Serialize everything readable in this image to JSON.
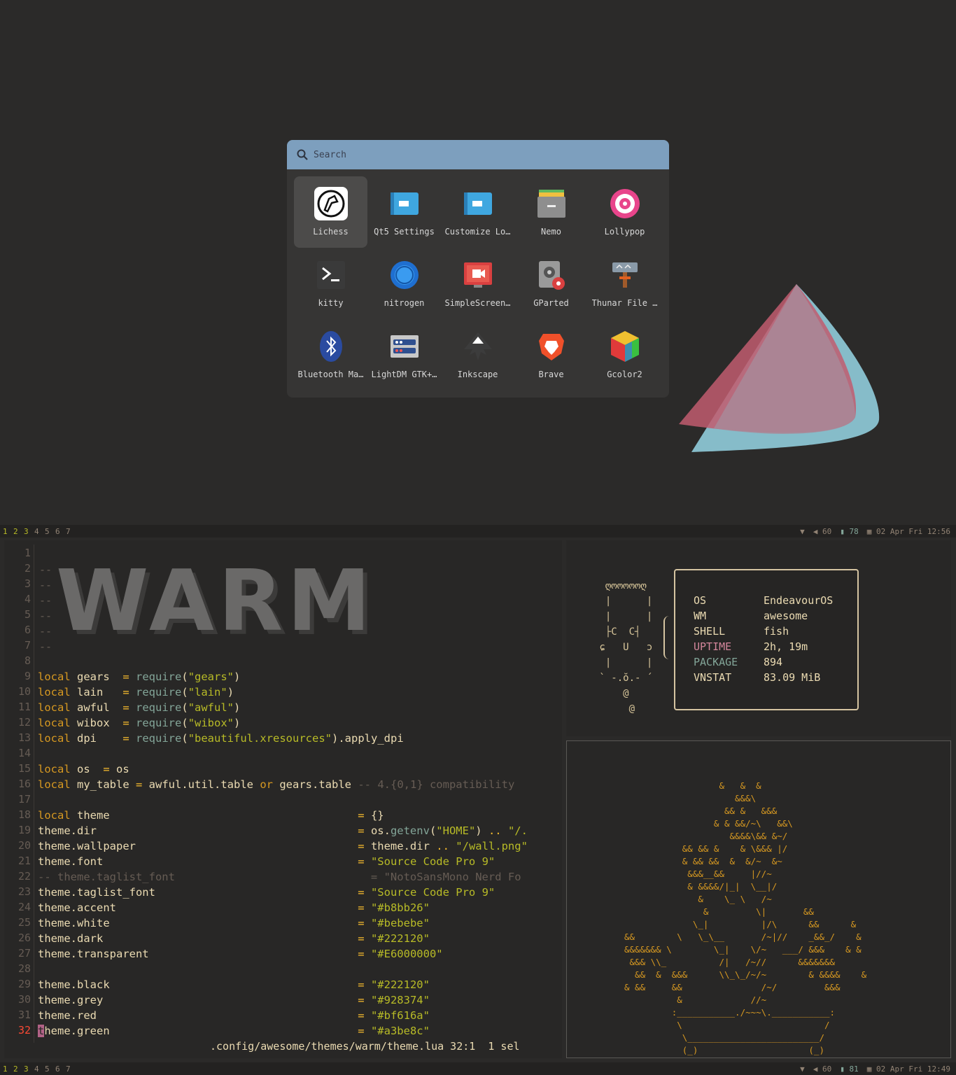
{
  "launcher": {
    "search_placeholder": "Search",
    "apps": [
      {
        "label": "Lichess",
        "icon": "lichess-icon",
        "selected": true
      },
      {
        "label": "Qt5 Settings",
        "icon": "settings-window-icon"
      },
      {
        "label": "Customize Lo…",
        "icon": "settings-window-icon"
      },
      {
        "label": "Nemo",
        "icon": "file-cabinet-icon"
      },
      {
        "label": "Lollypop",
        "icon": "lollypop-icon"
      },
      {
        "label": "kitty",
        "icon": "terminal-icon"
      },
      {
        "label": "nitrogen",
        "icon": "nitrogen-icon"
      },
      {
        "label": "SimpleScreen…",
        "icon": "screen-recorder-icon"
      },
      {
        "label": "GParted",
        "icon": "disk-partition-icon"
      },
      {
        "label": "Thunar File …",
        "icon": "file-manager-icon"
      },
      {
        "label": "Bluetooth Ma…",
        "icon": "bluetooth-icon"
      },
      {
        "label": "LightDM GTK+…",
        "icon": "lightdm-icon"
      },
      {
        "label": "Inkscape",
        "icon": "inkscape-icon"
      },
      {
        "label": "Brave",
        "icon": "brave-icon"
      },
      {
        "label": "Gcolor2",
        "icon": "color-cube-icon"
      }
    ]
  },
  "bar_top": {
    "tags": [
      "1",
      "2",
      "3",
      "4",
      "5",
      "6",
      "7"
    ],
    "volume": "60",
    "battery": "78",
    "datetime": "02 Apr Fri 12:56"
  },
  "bar_bottom": {
    "tags": [
      "1",
      "2",
      "3",
      "4",
      "5",
      "6",
      "7"
    ],
    "volume": "60",
    "battery": "81",
    "datetime": "02 Apr Fri 12:49"
  },
  "editor": {
    "line_numbers": [
      "1",
      "2",
      "3",
      "4",
      "5",
      "6",
      "7",
      "8",
      "9",
      "10",
      "11",
      "12",
      "13",
      "14",
      "15",
      "16",
      "17",
      "18",
      "19",
      "20",
      "21",
      "22",
      "23",
      "24",
      "25",
      "26",
      "27",
      "28",
      "29",
      "30",
      "31",
      "32"
    ],
    "status": ".config/awesome/themes/warm/theme.lua 32:1  1 sel",
    "banner_text": "WARM"
  },
  "fetch": {
    "rows": [
      {
        "key": "OS",
        "value": "EndeavourOS",
        "color": "#ebdbb2"
      },
      {
        "key": "WM",
        "value": "awesome",
        "color": "#ebdbb2"
      },
      {
        "key": "SHELL",
        "value": "fish",
        "color": "#ebdbb2"
      },
      {
        "key": "UPTIME",
        "value": "2h, 19m",
        "color": "#d3869b"
      },
      {
        "key": "PACKAGE",
        "value": "894",
        "color": "#83a598"
      },
      {
        "key": "VNSTAT",
        "value": "83.09 MiB",
        "color": "#ebdbb2"
      }
    ]
  },
  "colors": {
    "accent": "#b8bb26",
    "white": "#bebebe",
    "dark": "#222120",
    "red": "#bf616a",
    "green": "#a3be8c",
    "grey": "#928374"
  }
}
